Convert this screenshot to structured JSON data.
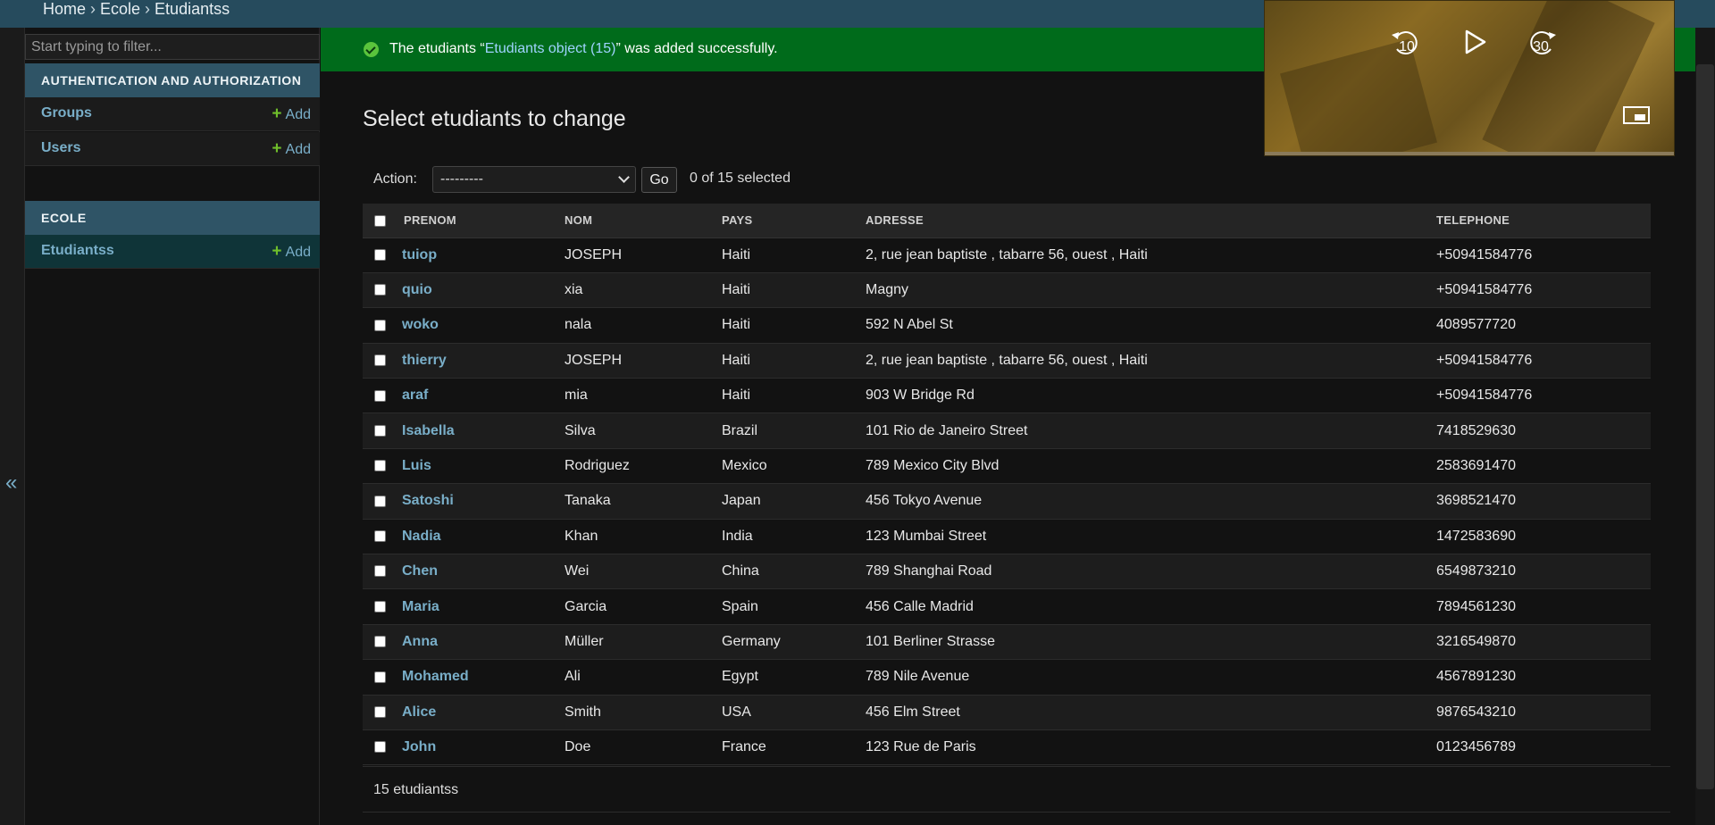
{
  "breadcrumbs": {
    "home": "Home",
    "app": "Ecole",
    "model": "Etudiantss",
    "separator": "›"
  },
  "sidebar": {
    "filter_placeholder": "Start typing to filter...",
    "collapse_label": "«",
    "modules": [
      {
        "caption": "AUTHENTICATION AND AUTHORIZATION",
        "items": [
          {
            "label": "Groups",
            "add": "Add"
          },
          {
            "label": "Users",
            "add": "Add"
          }
        ]
      },
      {
        "caption": "ECOLE",
        "items": [
          {
            "label": "Etudiantss",
            "add": "Add"
          }
        ]
      }
    ],
    "add_symbol": "+"
  },
  "message": {
    "before": "The etudiants “",
    "link": "Etudiants object (15)",
    "after": "” was added successfully."
  },
  "page_title": "Select etudiants to change",
  "actions": {
    "label": "Action:",
    "selected_value": "---------",
    "go": "Go",
    "selected_count": "0 of 15 selected"
  },
  "table": {
    "headers": [
      "PRENOM",
      "NOM",
      "PAYS",
      "ADRESSE",
      "TELEPHONE"
    ],
    "rows": [
      [
        "tuiop",
        "JOSEPH",
        "Haiti",
        "2, rue jean baptiste , tabarre 56, ouest , Haiti",
        "+50941584776"
      ],
      [
        "quio",
        "xia",
        "Haiti",
        "Magny",
        "+50941584776"
      ],
      [
        "woko",
        "nala",
        "Haiti",
        "592 N Abel St",
        "4089577720"
      ],
      [
        "thierry",
        "JOSEPH",
        "Haiti",
        "2, rue jean baptiste , tabarre 56, ouest , Haiti",
        "+50941584776"
      ],
      [
        "araf",
        "mia",
        "Haiti",
        "903 W Bridge Rd",
        "+50941584776"
      ],
      [
        "Isabella",
        "Silva",
        "Brazil",
        "101 Rio de Janeiro Street",
        "7418529630"
      ],
      [
        "Luis",
        "Rodriguez",
        "Mexico",
        "789 Mexico City Blvd",
        "2583691470"
      ],
      [
        "Satoshi",
        "Tanaka",
        "Japan",
        "456 Tokyo Avenue",
        "3698521470"
      ],
      [
        "Nadia",
        "Khan",
        "India",
        "123 Mumbai Street",
        "1472583690"
      ],
      [
        "Chen",
        "Wei",
        "China",
        "789 Shanghai Road",
        "6549873210"
      ],
      [
        "Maria",
        "Garcia",
        "Spain",
        "456 Calle Madrid",
        "7894561230"
      ],
      [
        "Anna",
        "Müller",
        "Germany",
        "101 Berliner Strasse",
        "3216549870"
      ],
      [
        "Mohamed",
        "Ali",
        "Egypt",
        "789 Nile Avenue",
        "4567891230"
      ],
      [
        "Alice",
        "Smith",
        "USA",
        "456 Elm Street",
        "9876543210"
      ],
      [
        "John",
        "Doe",
        "France",
        "123 Rue de Paris",
        "0123456789"
      ]
    ]
  },
  "paginator": "15 etudiantss",
  "video": {
    "rewind_seconds": "10",
    "forward_seconds": "30"
  },
  "colors": {
    "header": "#264b5d",
    "module_caption": "#2f5466",
    "link": "#79aec8",
    "success": "#006b1b",
    "add_plus": "#70bf2b"
  }
}
